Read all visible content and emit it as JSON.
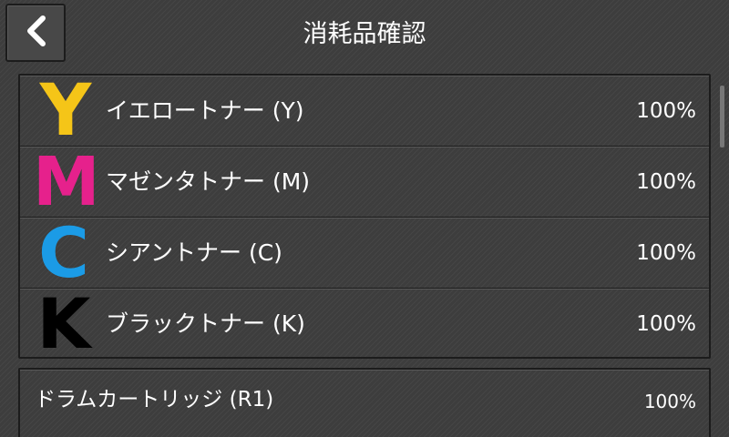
{
  "header": {
    "title": "消耗品確認",
    "back_icon": "chevron-left-icon"
  },
  "toners": [
    {
      "letter": "Y",
      "letter_color": "#f5c518",
      "label": "イエロートナー (Y)",
      "value": "100%"
    },
    {
      "letter": "M",
      "letter_color": "#e6218c",
      "label": "マゼンタトナー (M)",
      "value": "100%"
    },
    {
      "letter": "C",
      "letter_color": "#1b9be6",
      "label": "シアントナー (C)",
      "value": "100%"
    },
    {
      "letter": "K",
      "letter_color": "#000000",
      "label": "ブラックトナー (K)",
      "value": "100%"
    }
  ],
  "drum": {
    "label": "ドラムカートリッジ (R1)",
    "value": "100%"
  },
  "colors": {
    "background": "#3d3d3d",
    "border": "#1c1c1c",
    "text": "#ffffff",
    "scrollbar": "#777777"
  }
}
